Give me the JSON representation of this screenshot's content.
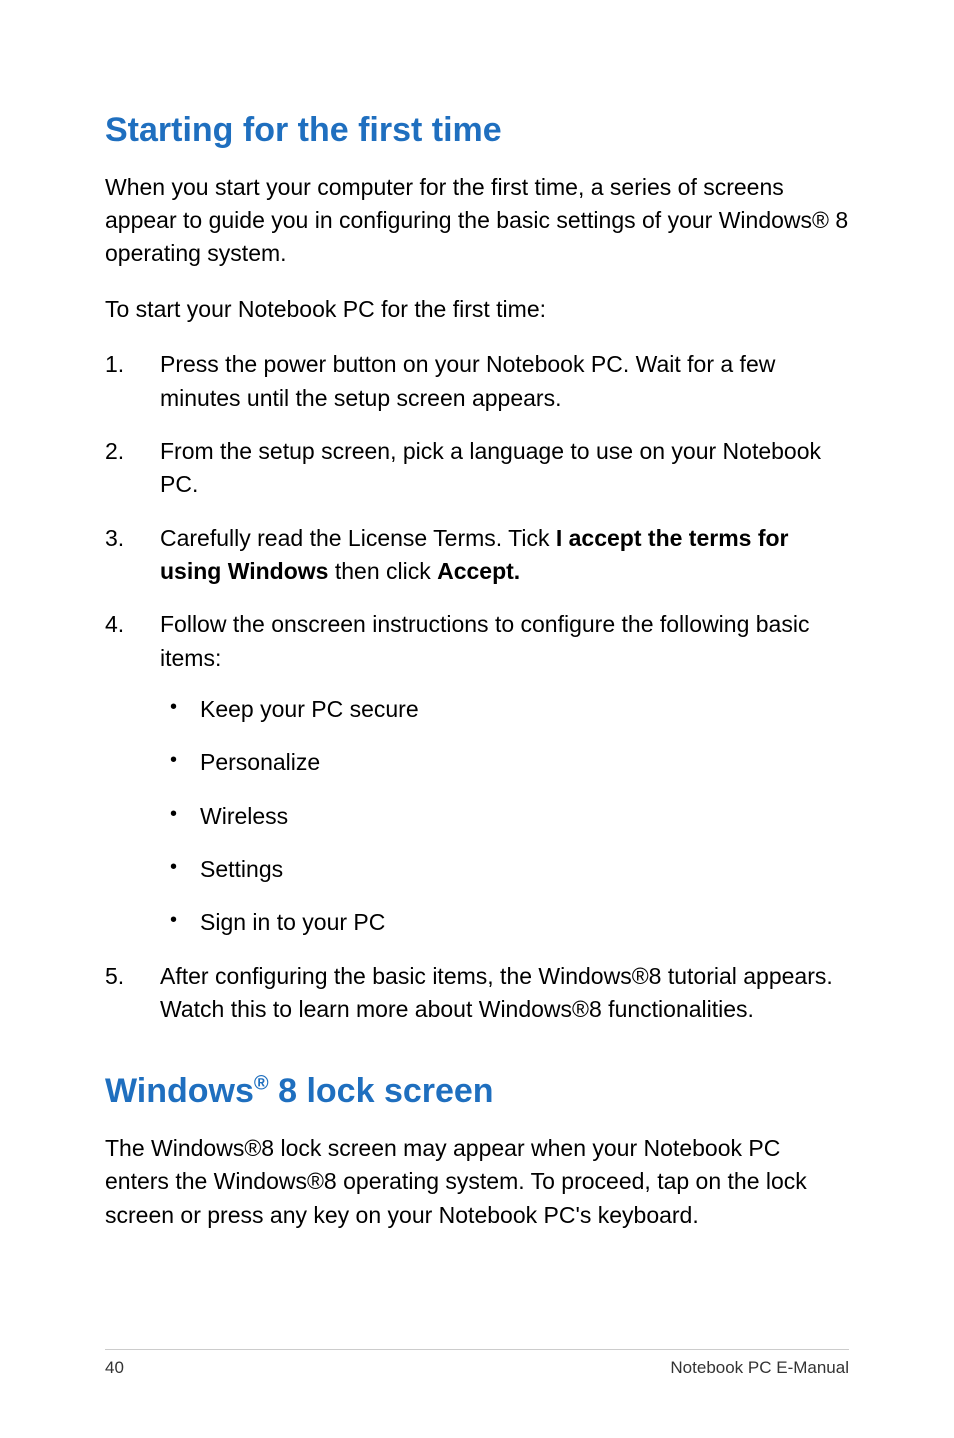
{
  "heading1": "Starting for the first time",
  "intro_para": "When you start your computer for the first time, a series of screens appear to guide you in configuring the basic settings of your Windows® 8 operating system.",
  "sub_para": "To start your Notebook PC for the first time:",
  "steps": {
    "s1": "Press the power button on your Notebook PC. Wait for a few minutes until the setup screen appears.",
    "s2": "From the setup screen, pick a language to use on your Notebook PC.",
    "s3_pre": "Carefully read the License Terms. Tick ",
    "s3_bold1": "I accept the terms for using Windows",
    "s3_mid": " then click ",
    "s3_bold2": "Accept.",
    "s4": "Follow the onscreen instructions to configure the following basic items:",
    "bullets": {
      "b1": "Keep your PC secure",
      "b2": "Personalize",
      "b3": "Wireless",
      "b4": "Settings",
      "b5": "Sign in to your PC"
    },
    "s5": "After configuring the basic items, the Windows®8 tutorial appears. Watch this to learn more about Windows®8 functionalities."
  },
  "heading2_pre": "Windows",
  "heading2_sup": "®",
  "heading2_post": " 8 lock screen",
  "lock_para": "The Windows®8 lock screen may appear when your Notebook PC enters the Windows®8 operating system. To proceed,  tap on the lock screen or press any key on your Notebook PC's keyboard.",
  "footer": {
    "page": "40",
    "title": "Notebook PC E-Manual"
  }
}
